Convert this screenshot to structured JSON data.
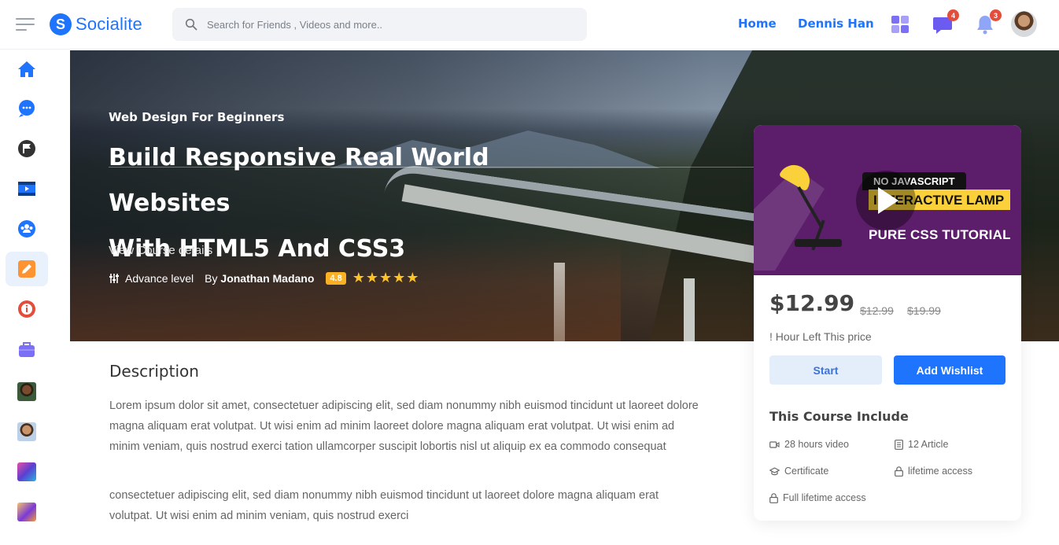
{
  "app": {
    "logo_letter": "S",
    "name": "Socialite"
  },
  "search": {
    "placeholder": "Search for Friends , Videos and more.."
  },
  "nav": {
    "home": "Home",
    "user": "Dennis Han"
  },
  "notifications": {
    "messages_count": "4",
    "alerts_count": "3"
  },
  "sidebar": {
    "items": [
      {
        "icon": "home-icon",
        "color": "#1e74fd"
      },
      {
        "icon": "chat-icon",
        "color": "#1e74fd"
      },
      {
        "icon": "flag-icon",
        "color": "#333"
      },
      {
        "icon": "video-icon",
        "color": "#1e74fd"
      },
      {
        "icon": "group-icon",
        "color": "#1e74fd"
      },
      {
        "icon": "edit-icon",
        "color": "#fe9431",
        "active": true
      },
      {
        "icon": "info-icon",
        "color": "#e44d3a"
      },
      {
        "icon": "briefcase-icon",
        "color": "#7b6ff6"
      }
    ]
  },
  "hero": {
    "subtitle": "Web Design For Beginners",
    "title_line1": "Build Responsive Real World Websites",
    "title_line2": "With HTML5 And CSS3",
    "details_link": "View Course details",
    "level": "Advance level",
    "by_prefix": "By",
    "author": "Jonathan Madano",
    "rating": "4.8",
    "stars": "★★★★★"
  },
  "description": {
    "title": "Description",
    "para1": "Lorem ipsum dolor sit amet, consectetuer adipiscing elit, sed diam nonummy nibh euismod tincidunt ut laoreet dolore magna aliquam erat volutpat. Ut wisi enim ad minim laoreet dolore magna aliquam erat volutpat. Ut wisi enim ad minim veniam, quis nostrud exerci tation ullamcorper suscipit lobortis nisl ut aliquip ex ea commodo consequat",
    "para2": "consectetuer adipiscing elit, sed diam nonummy nibh euismod tincidunt ut laoreet dolore magna aliquam erat volutpat. Ut wisi enim ad minim veniam, quis nostrud exerci"
  },
  "card": {
    "thumb_tag1": "NO JAVASCRIPT",
    "thumb_tag2": "INTERACTIVE LAMP",
    "thumb_tag3": "PURE CSS TUTORIAL",
    "price": "$12.99",
    "old_price1": "$12.99",
    "old_price2": "$19.99",
    "hours_left": "! Hour Left This price",
    "start_label": "Start",
    "wishlist_label": "Add Wishlist",
    "include_title": "This Course Include",
    "features": [
      {
        "icon": "video-camera-icon",
        "label": "28 hours video"
      },
      {
        "icon": "article-icon",
        "label": "12 Article"
      },
      {
        "icon": "certificate-icon",
        "label": "Certificate"
      },
      {
        "icon": "lock-icon",
        "label": "lifetime access"
      },
      {
        "icon": "lock-icon",
        "label": "Full lifetime access"
      }
    ]
  },
  "colors": {
    "accent": "#1e74fd",
    "star": "#ffc424",
    "rating_bg": "#fcb125",
    "thumb_bg": "#5c1d6b"
  }
}
